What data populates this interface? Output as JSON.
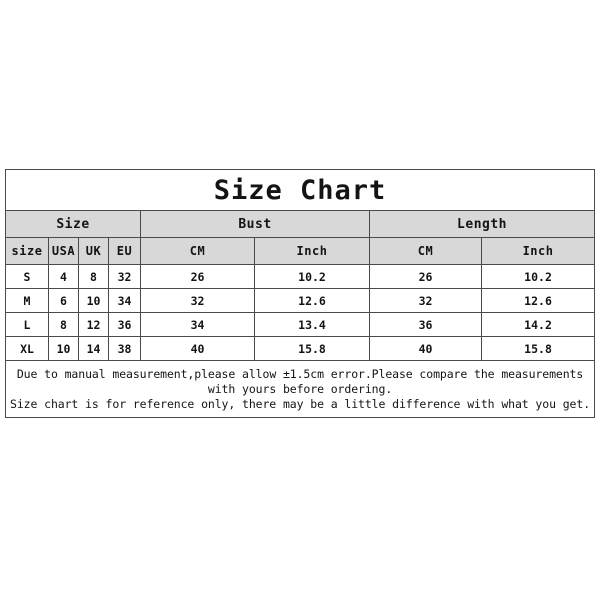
{
  "title": "Size Chart",
  "chart_data": {
    "type": "table",
    "title": "Size Chart",
    "group_headers": [
      {
        "label": "Size",
        "span": 4
      },
      {
        "label": "Bust",
        "span": 2
      },
      {
        "label": "Length",
        "span": 2
      }
    ],
    "columns": [
      "size",
      "USA",
      "UK",
      "EU",
      "CM",
      "Inch",
      "CM",
      "Inch"
    ],
    "rows": [
      [
        "S",
        "4",
        "8",
        "32",
        "26",
        "10.2",
        "26",
        "10.2"
      ],
      [
        "M",
        "6",
        "10",
        "34",
        "32",
        "12.6",
        "32",
        "12.6"
      ],
      [
        "L",
        "8",
        "12",
        "36",
        "34",
        "13.4",
        "36",
        "14.2"
      ],
      [
        "XL",
        "10",
        "14",
        "38",
        "40",
        "15.8",
        "40",
        "15.8"
      ]
    ]
  },
  "notes": {
    "line1": "Due to manual measurement,please allow ±1.5cm error.Please compare the measurements",
    "line2": "with yours before ordering.",
    "line3": "Size chart is for reference only, there may be a little difference with what you get."
  }
}
